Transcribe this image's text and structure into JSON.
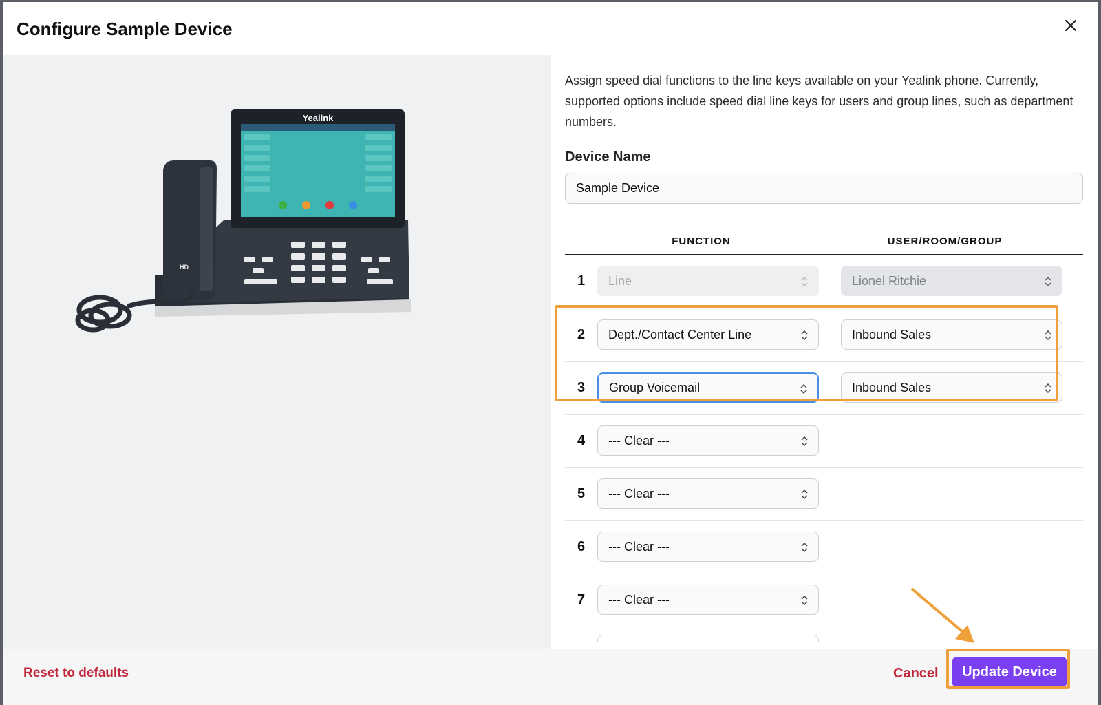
{
  "dialog": {
    "title": "Configure Sample Device"
  },
  "intro": "Assign speed dial functions to the line keys available on your Yealink phone. Currently, supported options include speed dial line keys for users and group lines, such as department numbers.",
  "device_name": {
    "label": "Device Name",
    "value": "Sample Device"
  },
  "phone_image": {
    "brand": "Yealink",
    "handset_badge": "HD"
  },
  "table": {
    "function_header": "FUNCTION",
    "user_header": "USER/ROOM/GROUP",
    "rows": [
      {
        "num": "1",
        "function": "Line",
        "user": "Lionel Ritchie"
      },
      {
        "num": "2",
        "function": "Dept./Contact Center Line",
        "user": "Inbound Sales"
      },
      {
        "num": "3",
        "function": "Group Voicemail",
        "user": "Inbound Sales"
      },
      {
        "num": "4",
        "function": "--- Clear ---"
      },
      {
        "num": "5",
        "function": "--- Clear ---"
      },
      {
        "num": "6",
        "function": "--- Clear ---"
      },
      {
        "num": "7",
        "function": "--- Clear ---"
      }
    ]
  },
  "footer": {
    "reset_label": "Reset to defaults",
    "cancel_label": "Cancel",
    "update_label": "Update Device"
  },
  "colors": {
    "accent": "#7b3ff2",
    "danger": "#c0283c",
    "annotation": "#f0a03a",
    "focus": "#4b8fe3"
  }
}
